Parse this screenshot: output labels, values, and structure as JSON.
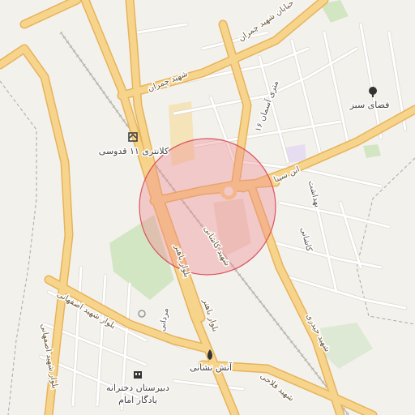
{
  "map": {
    "colors": {
      "background": "#f3f1ec",
      "major_road": "#f7d48c",
      "major_road_casing": "#e7b35a",
      "minor_road": "#ffffff",
      "minor_road_casing": "#dcd8d0",
      "park": "#d3e6c4",
      "railway": "#b9b5ad",
      "highlight_fill": "#f08a8f",
      "highlight_stroke": "#d9545c",
      "district_lines": "#a8a8a8"
    },
    "highlight_area": {
      "shape": "circle"
    },
    "street_labels": [
      "خیابان شهید چمران",
      "شهید چمران",
      "۱۶ متری آسمان",
      "ابن سینا",
      "بهداشت",
      "کاشانی",
      "شهید کاشانی",
      "بلوار باهنر",
      "بلوار باهنر",
      "بلوار شهید اصفهانی",
      "بلوار شهید اصفهانی",
      "مردانی",
      "شهید حیدری",
      "شهید فلاحی"
    ],
    "pois": [
      {
        "label": "فضای سبز",
        "icon": "tree-icon"
      },
      {
        "label": "کلانتری ۱۱ قدوسی",
        "icon": "police-icon"
      },
      {
        "label": "آتش نشانی",
        "icon": "fire-station-icon"
      },
      {
        "label": "دبیرستان دخترانه یادگار امام",
        "line1": "دبیرستان دخترانه",
        "line2": "یادگار امام",
        "icon": "school-icon"
      }
    ]
  }
}
